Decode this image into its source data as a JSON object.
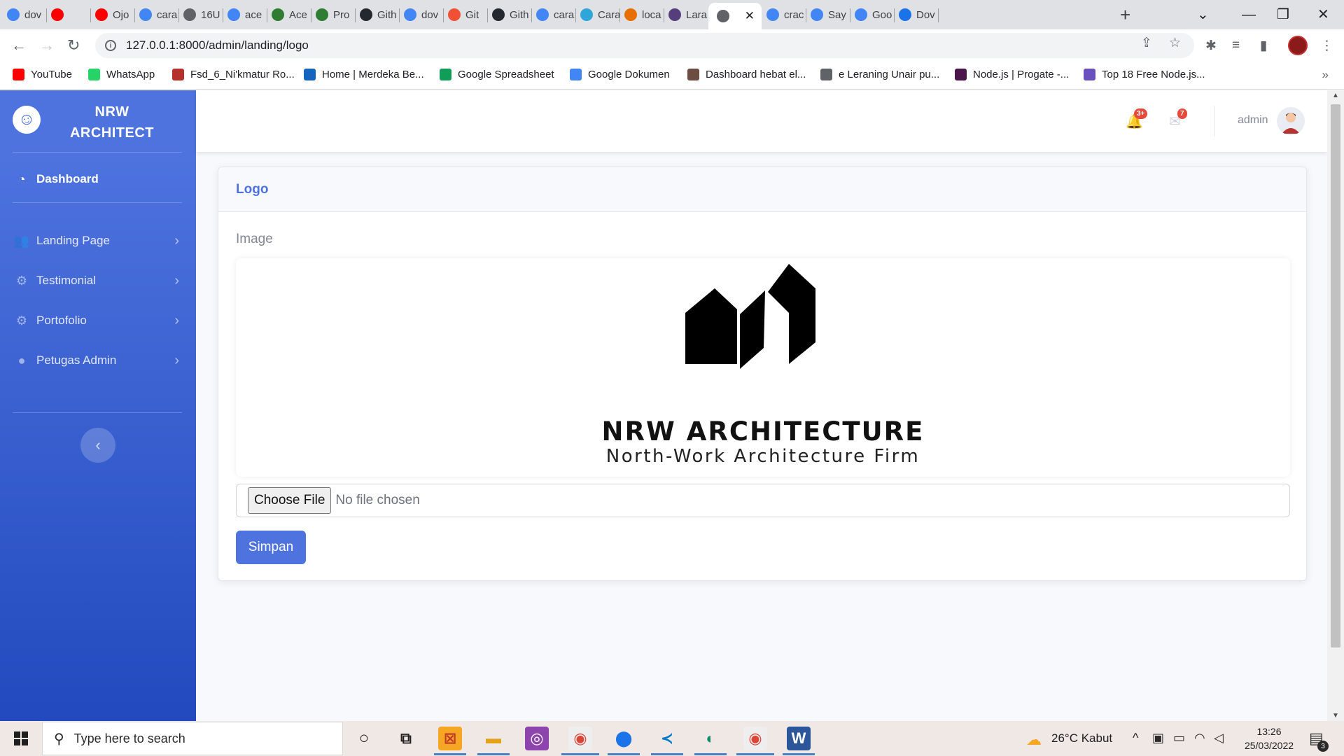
{
  "browser": {
    "tabs": [
      {
        "title": "dov",
        "icon": "google-icon",
        "color": "#4285f4"
      },
      {
        "title": "",
        "icon": "youtube-icon",
        "color": "#ff0000"
      },
      {
        "title": "Ojo",
        "icon": "youtube-icon",
        "color": "#ff0000"
      },
      {
        "title": "cara",
        "icon": "google-icon",
        "color": "#4285f4"
      },
      {
        "title": "16U",
        "icon": "globe-icon",
        "color": "#5f6368"
      },
      {
        "title": "ace",
        "icon": "google-icon",
        "color": "#4285f4"
      },
      {
        "title": "Ace",
        "icon": "owl-icon",
        "color": "#2e7d32"
      },
      {
        "title": "Pro",
        "icon": "owl-icon",
        "color": "#2e7d32"
      },
      {
        "title": "Gith",
        "icon": "github-icon",
        "color": "#24292f"
      },
      {
        "title": "dov",
        "icon": "google-icon",
        "color": "#4285f4"
      },
      {
        "title": "Git",
        "icon": "git-icon",
        "color": "#f05033"
      },
      {
        "title": "Gith",
        "icon": "github-icon",
        "color": "#24292f"
      },
      {
        "title": "cara",
        "icon": "google-icon",
        "color": "#4285f4"
      },
      {
        "title": "Cara",
        "icon": "edge-icon",
        "color": "#2fa6d9"
      },
      {
        "title": "loca",
        "icon": "phpmyadmin-icon",
        "color": "#e76f00"
      },
      {
        "title": "Lara",
        "icon": "bootstrap-icon",
        "color": "#563d7c"
      },
      {
        "title": "",
        "icon": "globe-icon",
        "color": "#5f6368",
        "active": true
      },
      {
        "title": "crac",
        "icon": "google-icon",
        "color": "#4285f4"
      },
      {
        "title": "Say",
        "icon": "google-translate-icon",
        "color": "#4285f4"
      },
      {
        "title": "Goo",
        "icon": "google-icon",
        "color": "#4285f4"
      },
      {
        "title": "Dov",
        "icon": "download-icon",
        "color": "#1a73e8"
      }
    ],
    "new_tab": "+",
    "url": "127.0.0.1:8000/admin/landing/logo",
    "bookmarks": [
      {
        "label": "YouTube",
        "color": "#ff0000"
      },
      {
        "label": "WhatsApp",
        "color": "#25d366"
      },
      {
        "label": "Fsd_6_Ni'kmatur Ro...",
        "color": "#b7312c"
      },
      {
        "label": "Home | Merdeka Be...",
        "color": "#1565c0"
      },
      {
        "label": "Google Spreadsheet",
        "color": "#0f9d58"
      },
      {
        "label": "Google Dokumen",
        "color": "#4285f4"
      },
      {
        "label": "Dashboard hebat el...",
        "color": "#6d4c41"
      },
      {
        "label": "e Leraning Unair pu...",
        "color": "#5f6368"
      },
      {
        "label": "Node.js | Progate -...",
        "color": "#4a154b"
      },
      {
        "label": "Top 18 Free Node.js...",
        "color": "#6a4fbf"
      }
    ]
  },
  "sidebar": {
    "brand_line1": "NRW",
    "brand_line2": "ARCHITECT",
    "dashboard": "Dashboard",
    "items": [
      {
        "label": "Landing Page",
        "icon": "users-icon"
      },
      {
        "label": "Testimonial",
        "icon": "cog-icon"
      },
      {
        "label": "Portofolio",
        "icon": "cog-icon"
      },
      {
        "label": "Petugas Admin",
        "icon": "user-icon"
      }
    ]
  },
  "topbar": {
    "alerts_badge": "3+",
    "messages_badge": "7",
    "user_name": "admin"
  },
  "card": {
    "title": "Logo",
    "image_label": "Image",
    "logo_title": "NRW ARCHITECTURE",
    "logo_subtitle": "North-Work Architecture Firm",
    "choose_file": "Choose File",
    "no_file": "No file chosen",
    "save": "Simpan"
  },
  "taskbar": {
    "search_placeholder": "Type here to search",
    "weather": "26°C  Kabut",
    "time": "13:26",
    "date": "25/03/2022",
    "notif_count": "3"
  },
  "colors": {
    "primary": "#4e73df",
    "sidebar_gradient_end": "#224abe",
    "danger": "#e74a3b"
  }
}
